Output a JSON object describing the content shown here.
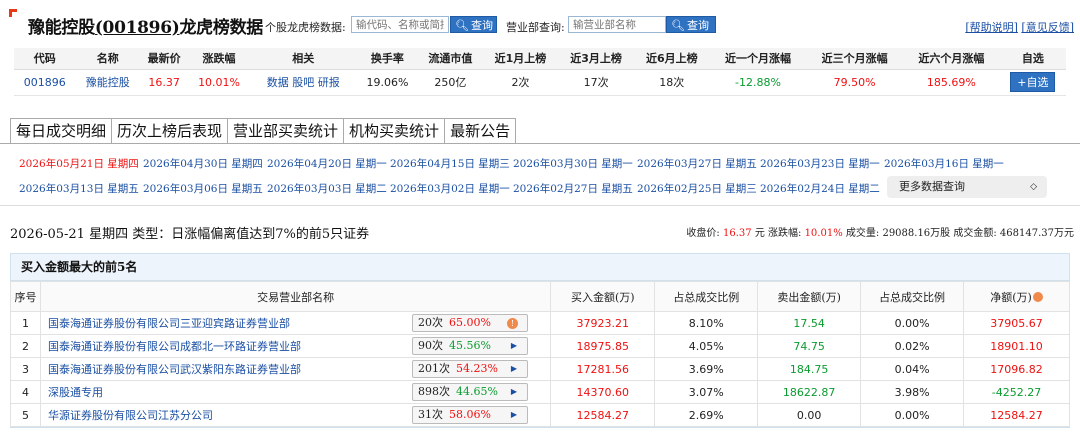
{
  "header": {
    "title_name": "豫能控股",
    "title_code": "(001896)",
    "title_suffix": "龙虎榜数据",
    "stock_query_label": "个股龙虎榜数据:",
    "stock_query_placeholder": "输代码、名称或简拼",
    "query_button": "查询",
    "dept_query_label": "营业部查询:",
    "dept_query_placeholder": "输营业部名称",
    "help_link": "[帮助说明]",
    "feedback_link": "[意见反馈]"
  },
  "stock_table": {
    "headers": [
      "代码",
      "名称",
      "最新价",
      "涨跌幅",
      "相关",
      "换手率",
      "流通市值",
      "近1月上榜",
      "近3月上榜",
      "近6月上榜",
      "近一个月涨幅",
      "近三个月涨幅",
      "近六个月涨幅",
      "自选"
    ],
    "row": {
      "code": "001896",
      "name": "豫能控股",
      "price": "16.37",
      "change": "10.01%",
      "related_data": "数据",
      "related_guba": "股吧",
      "related_report": "研报",
      "turnover": "19.06%",
      "float_cap": "250亿",
      "m1": "2次",
      "m3": "17次",
      "m6": "18次",
      "r1": "-12.88%",
      "r3": "79.50%",
      "r6": "185.69%",
      "add_watch": "+自选"
    }
  },
  "tabs": [
    "每日成交明细",
    "历次上榜后表现",
    "营业部买卖统计",
    "机构买卖统计",
    "最新公告"
  ],
  "dates": {
    "row1": [
      "2026年05月21日 星期四",
      "2026年04月30日 星期四",
      "2026年04月20日 星期一",
      "2026年04月15日 星期三",
      "2026年03月30日 星期一",
      "2026年03月27日 星期五",
      "2026年03月23日 星期一",
      "2026年03月16日 星期一"
    ],
    "row2": [
      "2026年03月13日 星期五",
      "2026年03月06日 星期五",
      "2026年03月03日 星期二",
      "2026年03月02日 星期一",
      "2026年02月27日 星期五",
      "2026年02月25日 星期三",
      "2026年02月24日 星期二"
    ],
    "more": "更多数据查询"
  },
  "detail": {
    "title": "2026-05-21 星期四 类型：日涨幅偏离值达到7%的前5只证券",
    "close_label": "收盘价:",
    "close_value": "16.37",
    "close_unit": "元",
    "change_label": "涨跌幅:",
    "change_value": "10.01%",
    "volume_label": "成交量:",
    "volume_value": "29088.16万股",
    "amount_label": "成交金额:",
    "amount_value": "468147.37万元"
  },
  "buy_section": {
    "title": "买入金额最大的前5名",
    "headers": [
      "序号",
      "交易营业部名称",
      "买入金额(万)",
      "占总成交比例",
      "卖出金额(万)",
      "占总成交比例",
      "净额(万)"
    ],
    "rows": [
      {
        "no": "1",
        "name": "国泰海通证券股份有限公司三亚迎宾路证券营业部",
        "count": "20次",
        "pct": "65.00%",
        "buy": "37923.21",
        "buy_ratio": "8.10%",
        "sell": "17.54",
        "sell_ratio": "0.00%",
        "net": "37905.67"
      },
      {
        "no": "2",
        "name": "国泰海通证券股份有限公司成都北一环路证券营业部",
        "count": "90次",
        "pct": "45.56%",
        "buy": "18975.85",
        "buy_ratio": "4.05%",
        "sell": "74.75",
        "sell_ratio": "0.02%",
        "net": "18901.10"
      },
      {
        "no": "3",
        "name": "国泰海通证券股份有限公司武汉紫阳东路证券营业部",
        "count": "201次",
        "pct": "54.23%",
        "buy": "17281.56",
        "buy_ratio": "3.69%",
        "sell": "184.75",
        "sell_ratio": "0.04%",
        "net": "17096.82"
      },
      {
        "no": "4",
        "name": "深股通专用",
        "count": "898次",
        "pct": "44.65%",
        "buy": "14370.60",
        "buy_ratio": "3.07%",
        "sell": "18622.87",
        "sell_ratio": "3.98%",
        "net": "-4252.27"
      },
      {
        "no": "5",
        "name": "华源证券股份有限公司江苏分公司",
        "count": "31次",
        "pct": "58.06%",
        "buy": "12584.27",
        "buy_ratio": "2.69%",
        "sell": "0.00",
        "sell_ratio": "0.00%",
        "net": "12584.27"
      }
    ]
  },
  "colors": {
    "accent_red": "#e11",
    "link_blue": "#1a4fa3",
    "button_blue": "#2f72c1",
    "green": "#0a9b2e"
  }
}
